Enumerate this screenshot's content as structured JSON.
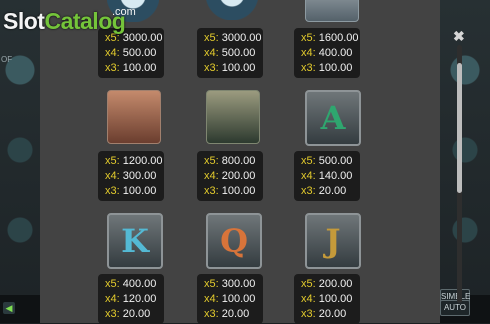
{
  "logo": {
    "part1": "Slot",
    "part2": "Catalog",
    "suffix": ".com"
  },
  "background": {
    "side_label": "OF",
    "buttons": [
      "SIMBLE",
      "AUTO"
    ]
  },
  "close_label": "✖",
  "rows": [
    {
      "items": [
        {
          "symbol": "gem-emblem",
          "pays": [
            {
              "mul": "x5:",
              "val": "3000.00"
            },
            {
              "mul": "x4:",
              "val": "500.00"
            },
            {
              "mul": "x3:",
              "val": "100.00"
            }
          ]
        },
        {
          "symbol": "eye-emblem",
          "pays": [
            {
              "mul": "x5:",
              "val": "3000.00"
            },
            {
              "mul": "x4:",
              "val": "500.00"
            },
            {
              "mul": "x3:",
              "val": "100.00"
            }
          ]
        },
        {
          "symbol": "wizard",
          "pays": [
            {
              "mul": "x5:",
              "val": "1600.00"
            },
            {
              "mul": "x4:",
              "val": "400.00"
            },
            {
              "mul": "x3:",
              "val": "100.00"
            }
          ]
        }
      ]
    },
    {
      "items": [
        {
          "symbol": "elf-princess",
          "pays": [
            {
              "mul": "x5:",
              "val": "1200.00"
            },
            {
              "mul": "x4:",
              "val": "300.00"
            },
            {
              "mul": "x3:",
              "val": "100.00"
            }
          ]
        },
        {
          "symbol": "old-warrior",
          "pays": [
            {
              "mul": "x5:",
              "val": "800.00"
            },
            {
              "mul": "x4:",
              "val": "200.00"
            },
            {
              "mul": "x3:",
              "val": "100.00"
            }
          ]
        },
        {
          "symbol": "letter-a",
          "letter": "A",
          "pays": [
            {
              "mul": "x5:",
              "val": "500.00"
            },
            {
              "mul": "x4:",
              "val": "140.00"
            },
            {
              "mul": "x3:",
              "val": "20.00"
            }
          ]
        }
      ]
    },
    {
      "items": [
        {
          "symbol": "letter-k",
          "letter": "K",
          "pays": [
            {
              "mul": "x5:",
              "val": "400.00"
            },
            {
              "mul": "x4:",
              "val": "120.00"
            },
            {
              "mul": "x3:",
              "val": "20.00"
            }
          ]
        },
        {
          "symbol": "letter-q",
          "letter": "Q",
          "pays": [
            {
              "mul": "x5:",
              "val": "300.00"
            },
            {
              "mul": "x4:",
              "val": "100.00"
            },
            {
              "mul": "x3:",
              "val": "20.00"
            }
          ]
        },
        {
          "symbol": "letter-j",
          "letter": "J",
          "pays": [
            {
              "mul": "x5:",
              "val": "200.00"
            },
            {
              "mul": "x4:",
              "val": "100.00"
            },
            {
              "mul": "x3:",
              "val": "20.00"
            }
          ]
        }
      ]
    }
  ],
  "colors": {
    "multiplier": "#e4cc2d",
    "value": "#f1f1f1",
    "panel": "#434343",
    "box": "#1c1c1c",
    "letter_a": "#2fa66f",
    "letter_k": "#54b9d4",
    "letter_q": "#d8743a",
    "letter_j": "#c59a3a"
  }
}
